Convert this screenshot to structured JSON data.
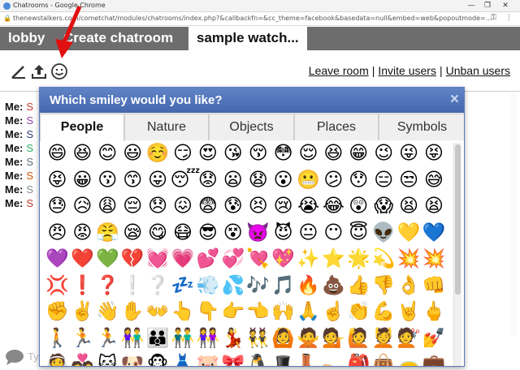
{
  "window": {
    "title": "Chatrooms - Google Chrome",
    "url": "thenewstalkers.com/cometchat/modules/chatrooms/index.php?&callbackfn=&cc_theme=facebook&basedata=null&embed=web&popoutmode=..."
  },
  "tabs": [
    {
      "label": "lobby"
    },
    {
      "label": "Create chatroom"
    },
    {
      "label": "sample watch..."
    }
  ],
  "toolbar": {
    "links": [
      {
        "label": "Leave room"
      },
      {
        "label": "Invite users"
      },
      {
        "label": "Unban users"
      }
    ],
    "separator": "|"
  },
  "chat": {
    "messages": [
      {
        "who": "Me:",
        "text": "S",
        "color": "#c0392b"
      },
      {
        "who": "Me:",
        "text": "S",
        "color": "#8e44ad"
      },
      {
        "who": "Me:",
        "text": "S",
        "color": "#2c3e80"
      },
      {
        "who": "Me:",
        "text": "S",
        "color": "#27ae60"
      },
      {
        "who": "Me:",
        "text": "S",
        "color": "#5d6d7e"
      },
      {
        "who": "Me:",
        "text": "S",
        "color": "#d35400"
      },
      {
        "who": "Me:",
        "text": "S",
        "color": "#7f8c8d"
      },
      {
        "who": "Me:",
        "text": "S",
        "color": "#c0392b"
      }
    ],
    "input_placeholder": "Ty"
  },
  "dialog": {
    "title": "Which smiley would you like?",
    "close": "×",
    "categories": [
      {
        "label": "People",
        "active": true
      },
      {
        "label": "Nature",
        "active": false
      },
      {
        "label": "Objects",
        "active": false
      },
      {
        "label": "Places",
        "active": false
      },
      {
        "label": "Symbols",
        "active": false
      }
    ],
    "emoji_rows": [
      [
        "😄",
        "😆",
        "😊",
        "😃",
        "☺️",
        "😏",
        "😍",
        "😘",
        "😚",
        "😳",
        "😌",
        "😆",
        "😁",
        "😉",
        "😜",
        "😝"
      ],
      [
        "😝",
        "😀",
        "😗",
        "😙",
        "😛",
        "😴",
        "😟",
        "😦",
        "😧",
        "😮",
        "😬",
        "😕",
        "😯",
        "😑",
        "😒",
        "😅"
      ],
      [
        "😓",
        "😥",
        "😩",
        "😔",
        "😞",
        "😖",
        "😨",
        "😰",
        "😣",
        "😢",
        "😭",
        "😂",
        "😲",
        "😱",
        "😫",
        "😫"
      ],
      [
        "😠",
        "😡",
        "😤",
        "😪",
        "😋",
        "😷",
        "😎",
        "😵",
        "👿",
        "😈",
        "😐",
        "😶",
        "😇",
        "👽",
        "💛",
        "💙"
      ],
      [
        "💜",
        "❤️",
        "💚",
        "💔",
        "💓",
        "💗",
        "💕",
        "💞",
        "💘",
        "💖",
        "✨",
        "⭐",
        "🌟",
        "💫",
        "💥",
        "💥"
      ],
      [
        "💢",
        "❗",
        "❓",
        "❕",
        "❔",
        "💤",
        "💨",
        "💦",
        "🎶",
        "🎵",
        "🔥",
        "💩",
        "👍",
        "👎",
        "👌",
        "👊"
      ],
      [
        "✊",
        "✌️",
        "👋",
        "✋",
        "👐",
        "👆",
        "👇",
        "👉",
        "👈",
        "🙌",
        "🙏",
        "☝️",
        "👏",
        "💪",
        "🤘",
        "🖕"
      ],
      [
        "🚶",
        "🏃",
        "🏃",
        "👫",
        "👪",
        "👬",
        "👭",
        "💃",
        "👯",
        "🙆",
        "🙅",
        "💁",
        "🙋",
        "💆",
        "💇",
        "💅"
      ],
      [
        "👰",
        "💑",
        "🐱",
        "🐶",
        "🐵",
        "👗",
        "🐷",
        "🎀",
        "🐧",
        "🎩",
        "👢",
        "👡",
        "🎒",
        "👜",
        "👝",
        "💼"
      ]
    ]
  }
}
